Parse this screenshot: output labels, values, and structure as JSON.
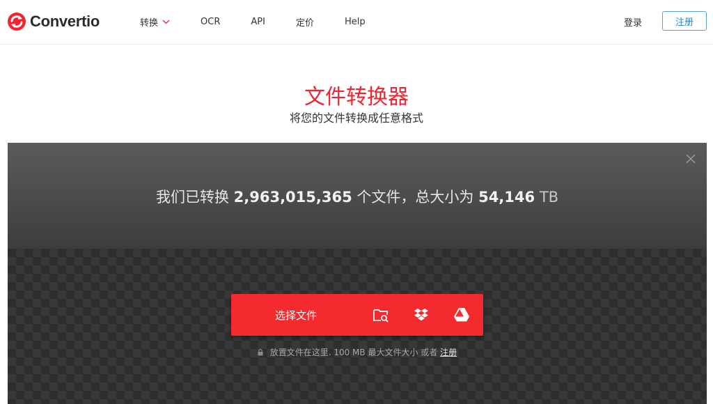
{
  "header": {
    "logo_text": "Convertio",
    "nav": [
      {
        "label": "转换",
        "has_dropdown": true
      },
      {
        "label": "OCR"
      },
      {
        "label": "API"
      },
      {
        "label": "定价"
      },
      {
        "label": "Help"
      }
    ],
    "login_label": "登录",
    "register_label": "注册"
  },
  "hero": {
    "title": "文件转换器",
    "subtitle": "将您的文件转换成任意格式"
  },
  "panel": {
    "stats_prefix": "我们已转换",
    "files_count": "2,963,015,365",
    "stats_middle": "个文件，总大小为",
    "total_size": "54,146",
    "size_unit": "TB",
    "choose_label": "选择文件",
    "icons": [
      "folder-search-icon",
      "dropbox-icon",
      "google-drive-icon"
    ],
    "hint_text": "放置文件在这里. 100 MB 最大文件大小 或者",
    "hint_register": "注册"
  },
  "colors": {
    "brand_red": "#f3242f",
    "button_red": "#f32b2e",
    "register_blue": "#2e86c9"
  }
}
